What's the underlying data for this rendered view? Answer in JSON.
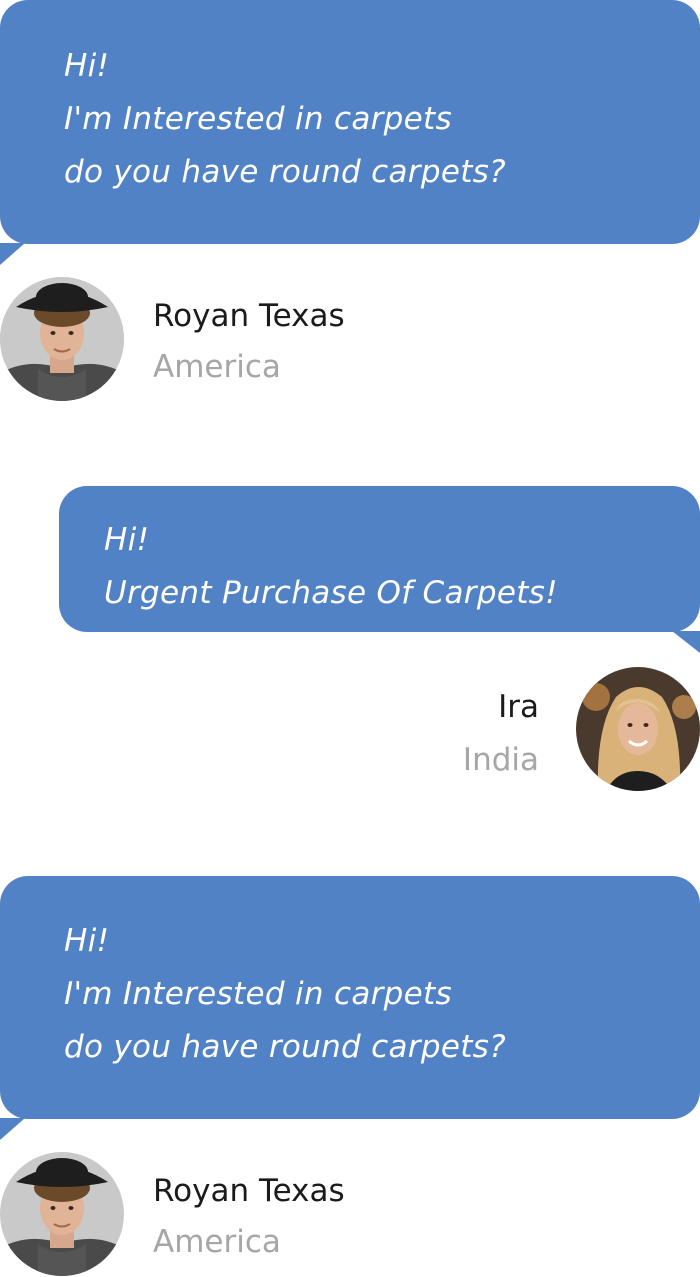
{
  "messages": [
    {
      "lines": [
        "Hi!",
        "I'm Interested in carpets",
        "do you have round carpets?"
      ],
      "sender_name": "Royan Texas",
      "sender_location": "America",
      "side": "left",
      "avatar": "young-man-with-hat-avatar"
    },
    {
      "lines": [
        "Hi!",
        "Urgent Purchase Of Carpets!"
      ],
      "sender_name": "Ira",
      "sender_location": "India",
      "side": "right",
      "avatar": "blonde-woman-avatar"
    },
    {
      "lines": [
        "Hi!",
        "I'm Interested in carpets",
        "do you have round carpets?"
      ],
      "sender_name": "Royan Texas",
      "sender_location": "America",
      "side": "left",
      "avatar": "young-man-with-hat-avatar"
    }
  ],
  "colors": {
    "bubble": "#5282c6",
    "bubble_text": "#ffffff",
    "name": "#1b1b1b",
    "location": "#a6a6a6"
  }
}
